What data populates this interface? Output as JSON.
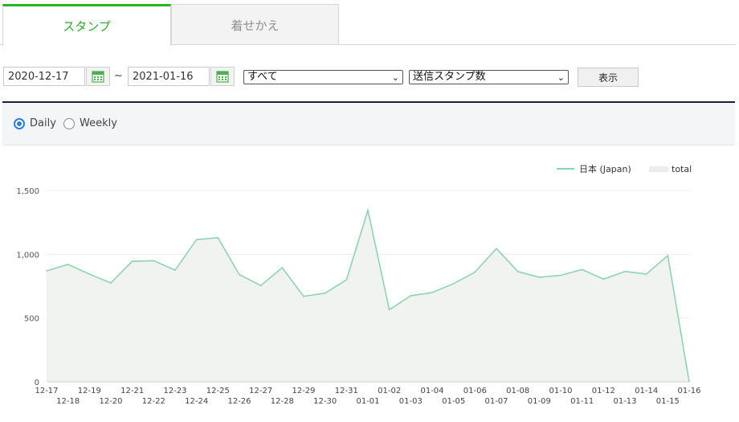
{
  "tabs": [
    {
      "label": "スタンプ",
      "active": true
    },
    {
      "label": "着せかえ",
      "active": false
    }
  ],
  "filters": {
    "start_date": "2020-12-17",
    "end_date": "2021-01-16",
    "separator": "~",
    "category_select": "すべて",
    "metric_select": "送信スタンプ数",
    "show_button": "表示"
  },
  "period": {
    "options": [
      {
        "label": "Daily",
        "checked": true
      },
      {
        "label": "Weekly",
        "checked": false
      }
    ]
  },
  "colors": {
    "accent_green": "#23b523",
    "line": "#8fd3b0",
    "area": "#f1f3f1",
    "radio_blue": "#2e7de0"
  },
  "chart_data": {
    "type": "area",
    "legend": [
      {
        "name": "日本 (Japan)",
        "style": "line"
      },
      {
        "name": "total",
        "style": "area"
      }
    ],
    "legend_position": "top-right",
    "grid": true,
    "ylim": [
      0,
      1500
    ],
    "yticks": [
      "0",
      "500",
      "1,000",
      "1,500"
    ],
    "x": [
      "12-17",
      "12-18",
      "12-19",
      "12-20",
      "12-21",
      "12-22",
      "12-23",
      "12-24",
      "12-25",
      "12-26",
      "12-27",
      "12-28",
      "12-29",
      "12-30",
      "12-31",
      "01-01",
      "01-02",
      "01-03",
      "01-04",
      "01-05",
      "01-06",
      "01-07",
      "01-08",
      "01-09",
      "01-10",
      "01-11",
      "01-12",
      "01-13",
      "01-14",
      "01-15",
      "01-16"
    ],
    "series": [
      {
        "name": "日本 (Japan)",
        "values": [
          870,
          920,
          845,
          775,
          945,
          950,
          875,
          1115,
          1130,
          840,
          755,
          895,
          670,
          695,
          800,
          1345,
          565,
          675,
          700,
          770,
          860,
          1045,
          865,
          820,
          835,
          880,
          805,
          865,
          845,
          990,
          0
        ]
      }
    ]
  }
}
